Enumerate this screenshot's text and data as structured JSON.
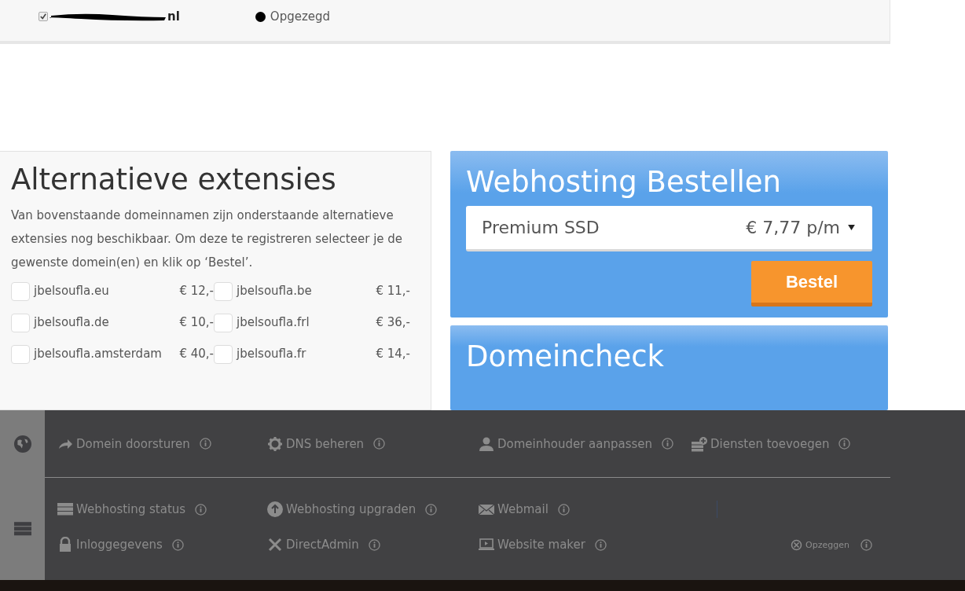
{
  "domain_row": {
    "checked": true,
    "name_visible": "nl",
    "status": "Opgezegd"
  },
  "alternatives": {
    "title": "Alternatieve extensies",
    "description": "Van bovenstaande domeinnamen zijn onderstaande alternatieve extensies nog beschikbaar. Om deze te registreren selecteer je de gewenste domein(en) en klik op ‘Bestel’.",
    "items": [
      {
        "name": "jbelsoufla.eu",
        "price": "€ 12,-",
        "checked": false
      },
      {
        "name": "jbelsoufla.be",
        "price": "€ 11,-",
        "checked": false
      },
      {
        "name": "jbelsoufla.de",
        "price": "€ 10,-",
        "checked": false
      },
      {
        "name": "jbelsoufla.frl",
        "price": "€ 36,-",
        "checked": false
      },
      {
        "name": "jbelsoufla.amsterdam",
        "price": "€ 40,-",
        "checked": false
      },
      {
        "name": "jbelsoufla.fr",
        "price": "€ 14,-",
        "checked": false
      }
    ]
  },
  "order": {
    "title": "Webhosting Bestellen",
    "package": "Premium SSD",
    "price": "€ 7,77 p/m",
    "button": "Bestel"
  },
  "domaincheck": {
    "title": "Domeincheck"
  },
  "actions": {
    "domain": [
      {
        "label": "Domein doorsturen",
        "kind": "forward"
      },
      {
        "label": "DNS beheren",
        "kind": "dns"
      },
      {
        "label": "Domeinhouder aanpassen",
        "kind": "owner"
      },
      {
        "label": "Diensten toevoegen",
        "kind": "services"
      }
    ],
    "hosting": [
      {
        "label": "Webhosting status",
        "kind": "status"
      },
      {
        "label": "Webhosting upgraden",
        "kind": "upgrade"
      },
      {
        "label": "Webmail",
        "kind": "mail"
      },
      {
        "kind": "empty"
      },
      {
        "label": "Inloggegevens",
        "kind": "login"
      },
      {
        "label": "DirectAdmin",
        "kind": "admin"
      },
      {
        "label": "Website maker",
        "kind": "builder"
      },
      {
        "label": "Opzeggen",
        "kind": "cancel"
      }
    ]
  }
}
